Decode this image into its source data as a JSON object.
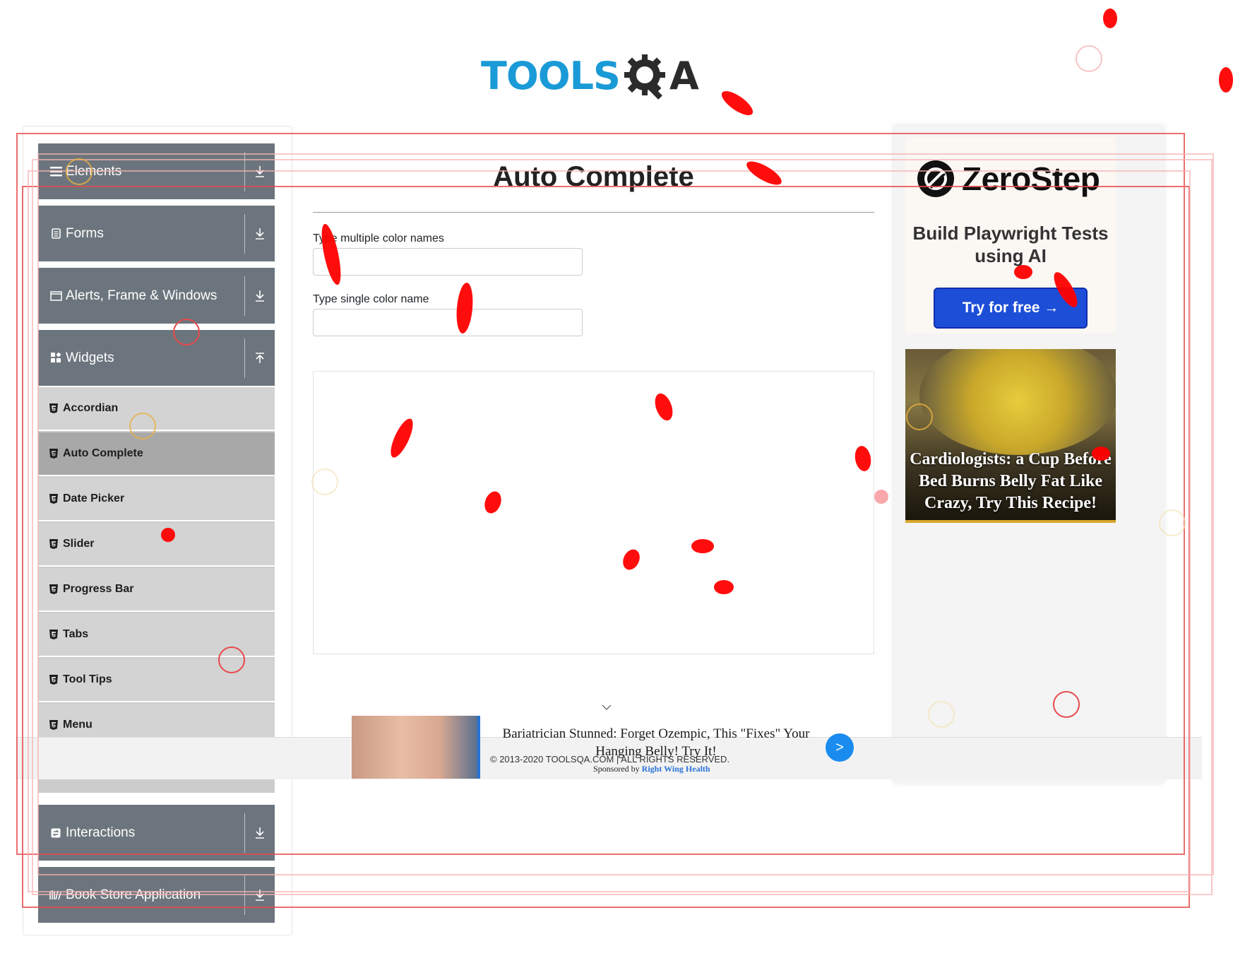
{
  "header": {
    "logo_tools": "TOOLS",
    "logo_qa": "A"
  },
  "sidebar": {
    "groups": [
      {
        "label": "Elements",
        "icon": "hamburger-icon",
        "state": "collapsed"
      },
      {
        "label": "Forms",
        "icon": "form-icon",
        "state": "collapsed"
      },
      {
        "label": "Alerts, Frame & Windows",
        "icon": "window-icon",
        "state": "collapsed"
      },
      {
        "label": "Widgets",
        "icon": "widgets-icon",
        "state": "expanded"
      },
      {
        "label": "Interactions",
        "icon": "interactions-icon",
        "state": "collapsed"
      },
      {
        "label": "Book Store Application",
        "icon": "books-icon",
        "state": "collapsed"
      }
    ],
    "widgets_items": [
      {
        "label": "Accordian",
        "active": false
      },
      {
        "label": "Auto Complete",
        "active": true
      },
      {
        "label": "Date Picker",
        "active": false
      },
      {
        "label": "Slider",
        "active": false
      },
      {
        "label": "Progress Bar",
        "active": false
      },
      {
        "label": "Tabs",
        "active": false
      },
      {
        "label": "Tool Tips",
        "active": false
      },
      {
        "label": "Menu",
        "active": false
      }
    ]
  },
  "main": {
    "title": "Auto Complete",
    "multi_label": "Type multiple color names",
    "single_label": "Type single color name",
    "multi_value": "",
    "single_value": ""
  },
  "right_ad": {
    "brand": "ZeroStep",
    "tagline": "Build Playwright Tests using AI",
    "cta": "Try for free →",
    "story": "Cardiologists: a Cup Before Bed Burns Belly Fat Like Crazy, Try This Recipe!"
  },
  "bottom_ad": {
    "headline": "Bariatrician Stunned: Forget Ozempic, This \"Fixes\" Your Hanging Belly! Try It!",
    "copyright": "© 2013-2020 TOOLSQA.COM | ALL RIGHTS RESERVED.",
    "sponsored_prefix": "Sponsored by",
    "sponsor": "Right Wing Health",
    "go": ">"
  },
  "colors": {
    "sidebar_group": "#6c757d",
    "sidebar_item": "#d3d3d3",
    "sidebar_item_active": "#a8a8a8",
    "logo_blue": "#1a9ad6",
    "cta_blue": "#1d4ed8",
    "overlay_red": "#ff0000"
  }
}
